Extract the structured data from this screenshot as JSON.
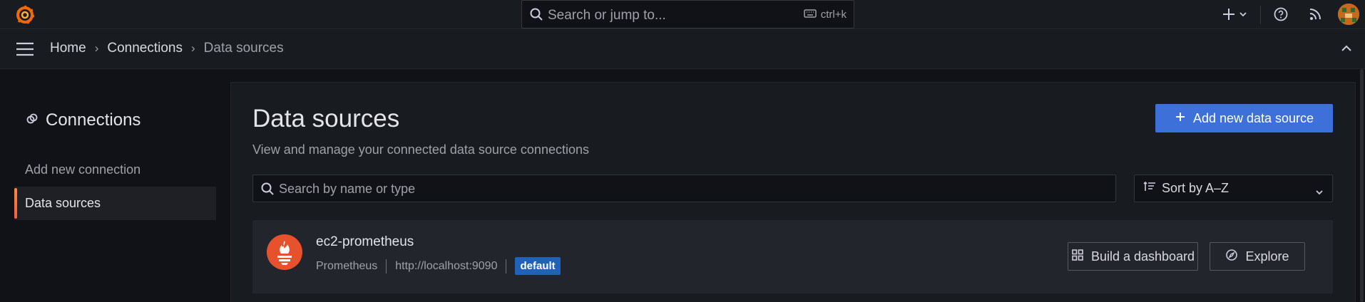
{
  "topbar": {
    "search_placeholder": "Search or jump to...",
    "search_shortcut": "ctrl+k",
    "icons": [
      "grafana-logo-icon",
      "search-icon",
      "keyboard-icon",
      "plus-icon",
      "chevron-down-icon",
      "help-icon",
      "news-feed-icon",
      "avatar"
    ]
  },
  "breadcrumb": {
    "items": [
      "Home",
      "Connections",
      "Data sources"
    ]
  },
  "sidenav": {
    "title": "Connections",
    "items": [
      {
        "label": "Add new connection",
        "active": false
      },
      {
        "label": "Data sources",
        "active": true
      }
    ]
  },
  "main": {
    "title": "Data sources",
    "subtitle": "View and manage your connected data source connections",
    "add_button": "Add new data source",
    "filter_placeholder": "Search by name or type",
    "sort_label": "Sort by A–Z",
    "datasources": [
      {
        "name": "ec2-prometheus",
        "type": "Prometheus",
        "url": "http://localhost:9090",
        "badge": "default",
        "actions": [
          "Build a dashboard",
          "Explore"
        ]
      }
    ]
  },
  "colors": {
    "background": "#111217",
    "surface": "#181b1f",
    "primary_button": "#3d71d9",
    "badge": "#1f62b8",
    "active_accent": "#ff8833",
    "prometheus": "#e6522c"
  }
}
